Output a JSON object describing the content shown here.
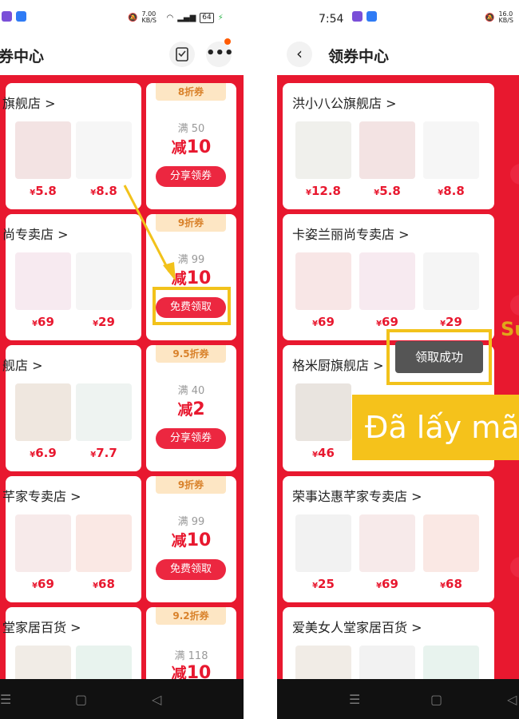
{
  "left": {
    "time": "",
    "net_speed": "7.00 KB/S",
    "battery": "64",
    "title": "券中心",
    "stores": [
      {
        "name": "旗舰店 >",
        "discount": "8折券",
        "min": "满 50",
        "cut_label": "减",
        "cut_value": "10",
        "button": "分享领券",
        "prices": [
          {
            "sym": "¥",
            "val": "5.8"
          },
          {
            "sym": "¥",
            "val": "8.8"
          }
        ]
      },
      {
        "name": "尚专卖店 >",
        "discount": "9折券",
        "min": "满 99",
        "cut_label": "减",
        "cut_value": "10",
        "button": "免费领取",
        "prices": [
          {
            "sym": "¥",
            "val": "69"
          },
          {
            "sym": "¥",
            "val": "29"
          }
        ]
      },
      {
        "name": "舰店 >",
        "discount": "9.5折券",
        "min": "满 40",
        "cut_label": "减",
        "cut_value": "2",
        "button": "分享领券",
        "prices": [
          {
            "sym": "¥",
            "val": "6.9"
          },
          {
            "sym": "¥",
            "val": "7.7"
          }
        ]
      },
      {
        "name": "芊家专卖店 >",
        "discount": "9折券",
        "min": "满 99",
        "cut_label": "减",
        "cut_value": "10",
        "button": "免费领取",
        "prices": [
          {
            "sym": "¥",
            "val": "69"
          },
          {
            "sym": "¥",
            "val": "68"
          }
        ]
      },
      {
        "name": "堂家居百货 >",
        "discount": "9.2折券",
        "min": "满 118",
        "cut_label": "减",
        "cut_value": "10",
        "button": "",
        "prices": []
      }
    ]
  },
  "right": {
    "time": "7:54",
    "net_speed": "16.0 KB/S",
    "title": "领券中心",
    "toast": "领取成功",
    "banner": "Đã lấy mã",
    "su": "Su",
    "stores": [
      {
        "name": "洪小八公旗舰店 >",
        "prices": [
          {
            "sym": "¥",
            "val": "12.8"
          },
          {
            "sym": "¥",
            "val": "5.8"
          },
          {
            "sym": "¥",
            "val": "8.8"
          }
        ]
      },
      {
        "name": "卡姿兰丽尚专卖店 >",
        "prices": [
          {
            "sym": "¥",
            "val": "69"
          },
          {
            "sym": "¥",
            "val": "69"
          },
          {
            "sym": "¥",
            "val": "29"
          }
        ]
      },
      {
        "name": "格米厨旗舰店 >",
        "prices": [
          {
            "sym": "¥",
            "val": "46"
          }
        ]
      },
      {
        "name": "荣事达惠芊家专卖店 >",
        "prices": [
          {
            "sym": "¥",
            "val": "25"
          },
          {
            "sym": "¥",
            "val": "69"
          },
          {
            "sym": "¥",
            "val": "68"
          }
        ]
      },
      {
        "name": "爱美女人堂家居百货 >",
        "prices": []
      }
    ]
  },
  "icons": {
    "back": "‹",
    "more": "•••",
    "nav_menu": "☰",
    "nav_home": "▢",
    "nav_back": "◁"
  },
  "colors": {
    "accent": "#e8182f",
    "highlight": "#f2c21b",
    "coupon_tag": "#fde6c4"
  }
}
